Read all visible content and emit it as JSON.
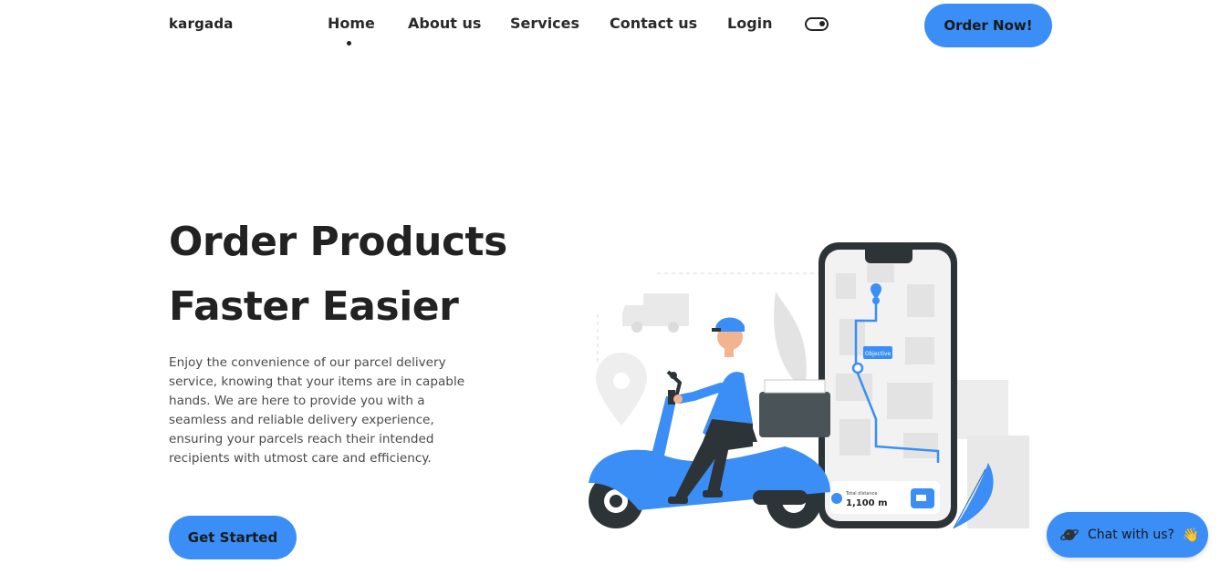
{
  "nav": {
    "logo": "kargada",
    "items": [
      {
        "label": "Home",
        "active": true
      },
      {
        "label": "About us"
      },
      {
        "label": "Services"
      },
      {
        "label": "Contact us"
      },
      {
        "label": "Login"
      }
    ],
    "theme_toggle_icon": "toggle-icon",
    "cta_label": "Order Now!"
  },
  "hero": {
    "title_line1": "Order Products",
    "title_line2": "Faster Easier",
    "description": "Enjoy the convenience of our parcel delivery service, knowing that your items are in capable hands. We are here to provide you with a seamless and reliable delivery experience, ensuring your parcels reach their intended recipients with utmost care and efficiency.",
    "button_label": "Get Started"
  },
  "illustration": {
    "map_label": "Objective",
    "distance_label": "Total distance",
    "distance_value": "1,100 m"
  },
  "chat": {
    "label": "Chat with us?",
    "icon": "planet-icon",
    "emoji": "👋"
  },
  "colors": {
    "accent": "#3a8ef6",
    "text_dark": "#222222",
    "text_body": "#4a4a4a"
  }
}
